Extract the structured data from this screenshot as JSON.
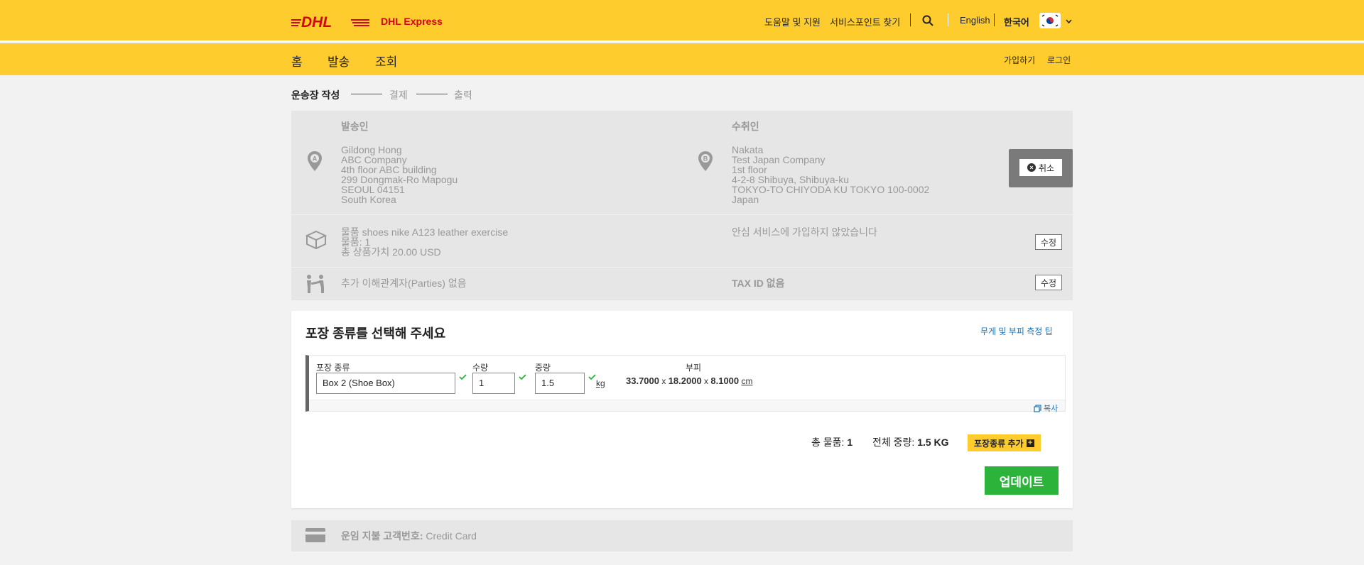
{
  "header": {
    "brand": "DHL",
    "brand_sub": "DHL Express",
    "help": "도움말 및 지원",
    "service_point": "서비스포인트 찾기",
    "lang_en": "English",
    "lang_ko": "한국어"
  },
  "nav": {
    "items": [
      {
        "label": "홈"
      },
      {
        "label": "발송"
      },
      {
        "label": "조회"
      }
    ],
    "signup": "가입하기",
    "login": "로그인"
  },
  "steps": [
    {
      "label": "운송장 작성",
      "active": true
    },
    {
      "label": "결제",
      "active": false
    },
    {
      "label": "출력",
      "active": false
    }
  ],
  "sender": {
    "heading": "발송인",
    "marker": "A",
    "lines": [
      "Gildong Hong",
      "ABC Company",
      "4th floor ABC building",
      "299 Dongmak-Ro Mapogu",
      "SEOUL 04151",
      "South Korea"
    ]
  },
  "receiver": {
    "heading": "수취인",
    "marker": "B",
    "lines": [
      "Nakata",
      "Test Japan Company",
      "1st floor",
      "4-2-8 Shibuya, Shibuya-ku",
      "TOKYO-TO CHIYODA KU TOKYO 100-0002",
      "Japan"
    ]
  },
  "cancel_label": "취소",
  "items_summary": {
    "line1": "물품 shoes nike A123 leather exercise",
    "line2": "물품: 1",
    "line3": "총 상품가치 20.00 USD",
    "insurance": "안심 서비스에 가입하지 않았습니다",
    "edit": "수정"
  },
  "parties": {
    "text": "추가 이해관계자(Parties) 없음",
    "tax": "TAX ID 없음",
    "edit": "수정"
  },
  "packaging": {
    "title": "포장 종류를 선택해 주세요",
    "tip": "무게 및 부피 측정 팁",
    "type_label": "포장 종류",
    "type_value": "Box 2 (Shoe Box)",
    "qty_label": "수량",
    "qty_value": "1",
    "weight_label": "중량",
    "weight_value": "1.5",
    "weight_unit": "kg",
    "dims_label": "부피",
    "length": "33.7000",
    "width": "18.2000",
    "height": "8.1000",
    "dim_sep": "x",
    "dim_unit": "cm",
    "copy": "복사",
    "total_items_label": "총 물품:",
    "total_items_value": "1",
    "total_weight_label": "전체 중량:",
    "total_weight_value": "1.5 KG",
    "add_package": "포장종류 추가",
    "update": "업데이트"
  },
  "payment": {
    "label": "운임 지불 고객번호:",
    "value": "Credit Card"
  },
  "colors": {
    "brand_yellow": "#ffcc2e",
    "brand_red": "#d40511",
    "update_green": "#2bb33a",
    "link_blue": "#1a73b8"
  }
}
